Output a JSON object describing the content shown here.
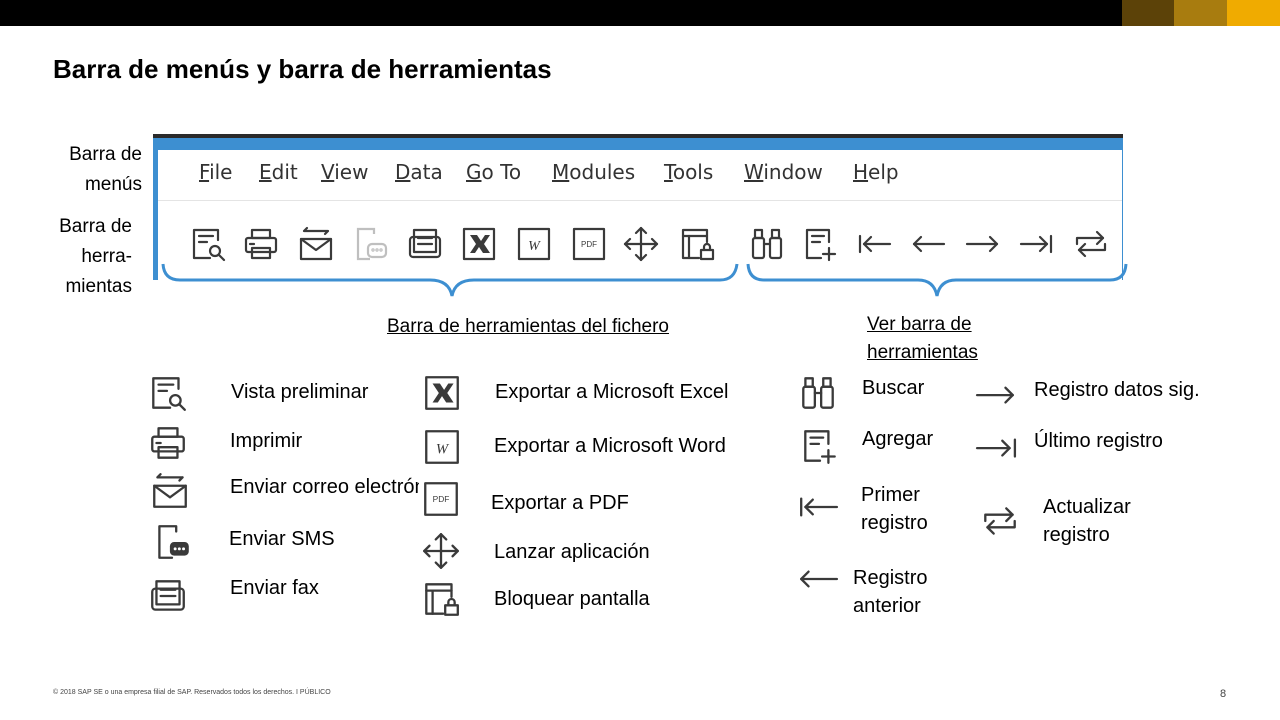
{
  "slide": {
    "title": "Barra de menús y barra de herramientas",
    "footer": "© 2018 SAP SE o una empresa filial de SAP. Reservados todos los derechos.   I    PÚBLICO",
    "page_number": "8"
  },
  "side_labels": {
    "menu_bar": "Barra de menús",
    "toolbar": "Barra de herra- mientas"
  },
  "menu": {
    "items": [
      "File",
      "Edit",
      "View",
      "Data",
      "Go To",
      "Modules",
      "Tools",
      "Window",
      "Help"
    ]
  },
  "toolbar_icons": [
    "preview-icon",
    "print-icon",
    "email-icon",
    "sms-icon",
    "fax-icon",
    "excel-icon",
    "word-icon",
    "pdf-icon",
    "launch-app-icon",
    "lock-screen-icon",
    "binoculars-icon",
    "add-icon",
    "first-record-icon",
    "previous-record-icon",
    "next-record-icon",
    "last-record-icon",
    "refresh-record-icon"
  ],
  "sections": {
    "file_toolbar": "Barra de herramientas del fichero",
    "view_toolbar": "Ver barra de herramientas"
  },
  "legend": {
    "col1": [
      {
        "icon": "preview-icon",
        "label": "Vista preliminar"
      },
      {
        "icon": "print-icon",
        "label": "Imprimir"
      },
      {
        "icon": "email-icon",
        "label": "Enviar correo electrónico"
      },
      {
        "icon": "sms-icon",
        "label": "Enviar SMS"
      },
      {
        "icon": "fax-icon",
        "label": "Enviar fax"
      }
    ],
    "col2": [
      {
        "icon": "excel-icon",
        "label": "Exportar a Microsoft Excel"
      },
      {
        "icon": "word-icon",
        "label": "Exportar a Microsoft Word"
      },
      {
        "icon": "pdf-icon",
        "label": "Exportar a PDF"
      },
      {
        "icon": "launch-app-icon",
        "label": "Lanzar aplicación"
      },
      {
        "icon": "lock-screen-icon",
        "label": "Bloquear pantalla"
      }
    ],
    "col3": [
      {
        "icon": "binoculars-icon",
        "label": "Buscar"
      },
      {
        "icon": "add-icon",
        "label": "Agregar"
      },
      {
        "icon": "first-record-icon",
        "label": "Primer registro"
      },
      {
        "icon": "previous-record-icon",
        "label": "Registro anterior"
      }
    ],
    "col4": [
      {
        "icon": "next-record-icon",
        "label": "Registro datos sig."
      },
      {
        "icon": "last-record-icon",
        "label": "Último registro"
      },
      {
        "icon": "refresh-record-icon",
        "label": "Actualizar registro"
      }
    ]
  },
  "colors": {
    "brand_gold_dark": "#7a5a0d",
    "brand_gold": "#b0830f",
    "brand_gold_light": "#f0ab00",
    "frame_blue": "#3d8fd1"
  }
}
